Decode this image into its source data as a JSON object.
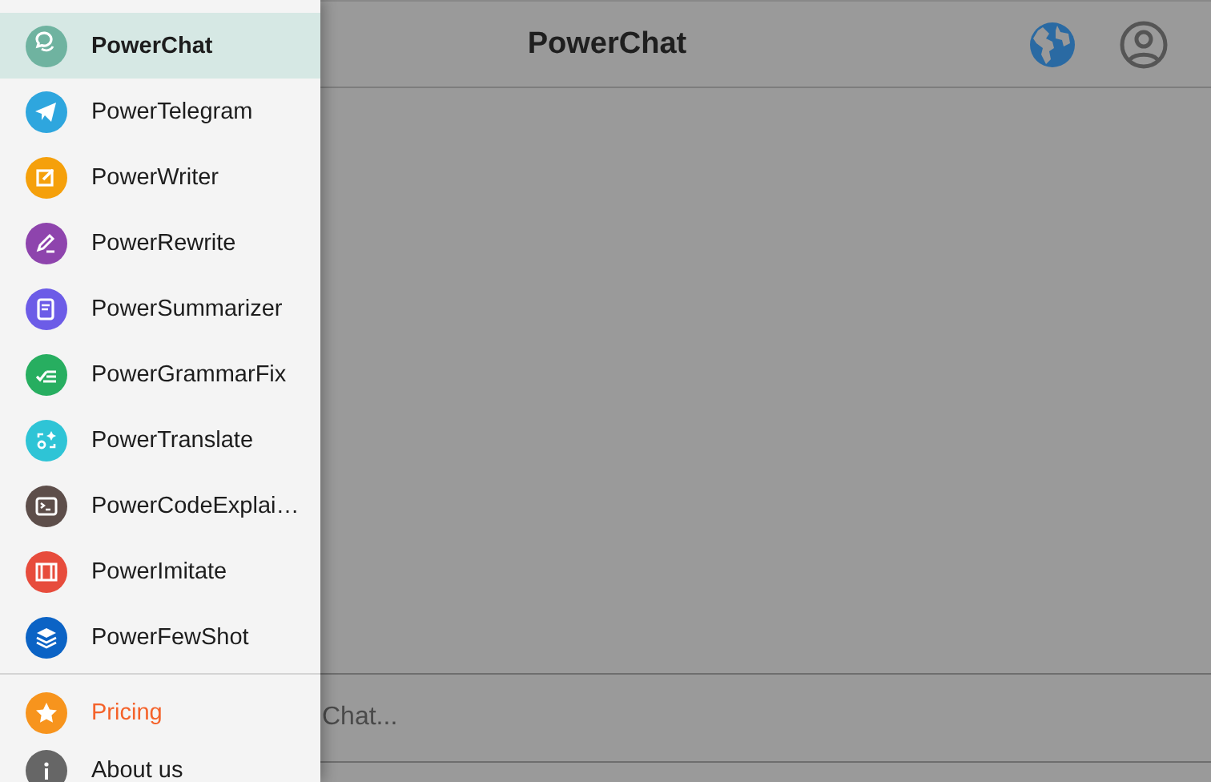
{
  "header": {
    "title": "PowerChat"
  },
  "composer": {
    "placeholder": "Chat..."
  },
  "drawer": {
    "items": [
      {
        "label": "PowerChat",
        "selected": true,
        "color": "#6fb3a0"
      },
      {
        "label": "PowerTelegram",
        "selected": false,
        "color": "#2ea6de"
      },
      {
        "label": "PowerWriter",
        "selected": false,
        "color": "#f5a00b"
      },
      {
        "label": "PowerRewrite",
        "selected": false,
        "color": "#8e44ad"
      },
      {
        "label": "PowerSummarizer",
        "selected": false,
        "color": "#6c5ce7"
      },
      {
        "label": "PowerGrammarFix",
        "selected": false,
        "color": "#27ae60"
      },
      {
        "label": "PowerTranslate",
        "selected": false,
        "color": "#2ec4d6"
      },
      {
        "label": "PowerCodeExplai…",
        "selected": false,
        "color": "#5d4e4a"
      },
      {
        "label": "PowerImitate",
        "selected": false,
        "color": "#e74c3c"
      },
      {
        "label": "PowerFewShot",
        "selected": false,
        "color": "#0b63c5"
      }
    ],
    "footer_items": [
      {
        "label": "Pricing",
        "kind": "accent",
        "color": "#f7941d"
      },
      {
        "label": "About us",
        "kind": "plain",
        "color": "#666666"
      }
    ]
  }
}
